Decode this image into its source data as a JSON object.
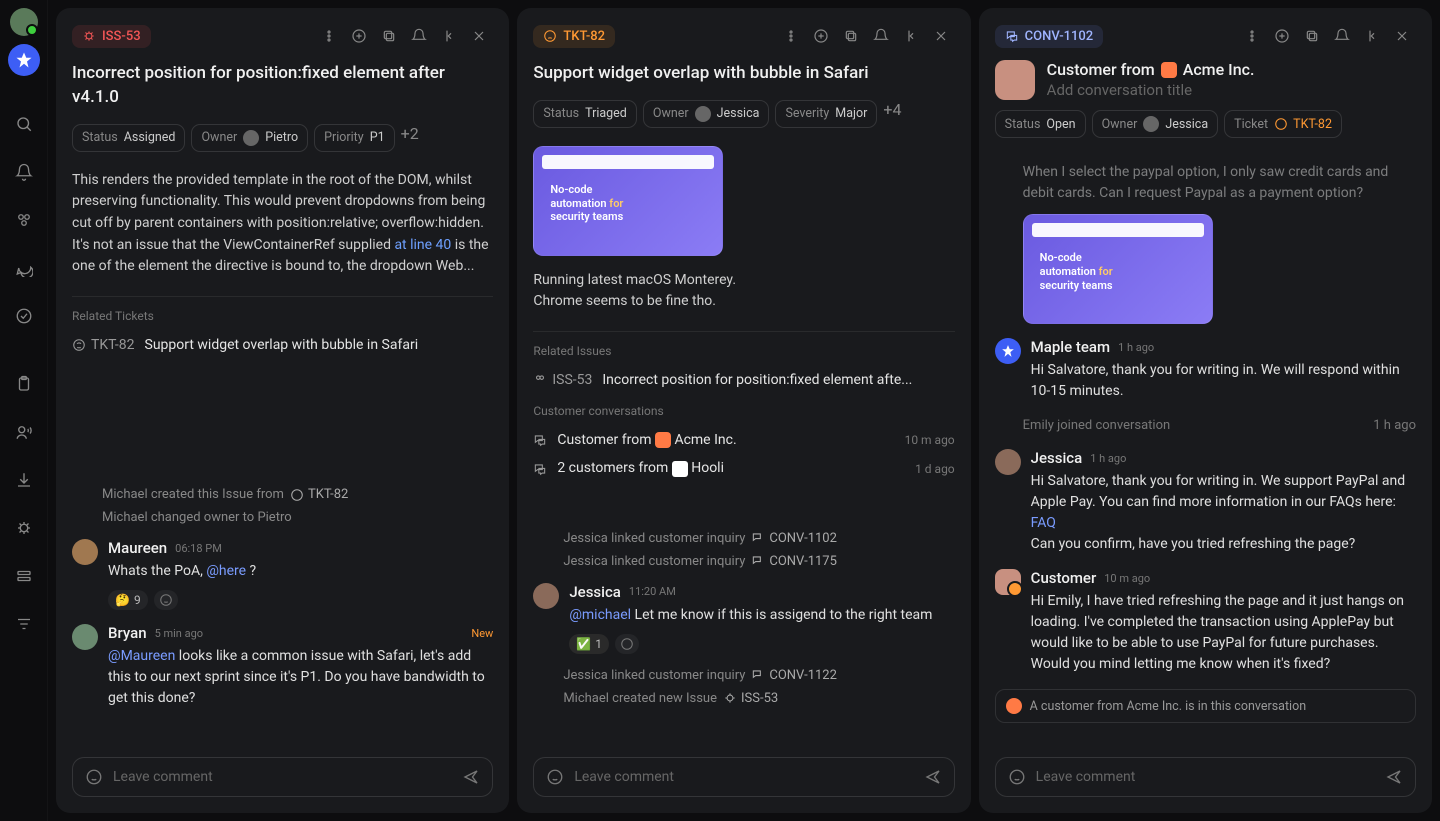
{
  "rail": {
    "icons": [
      "search",
      "bell",
      "team",
      "chat",
      "check",
      "clipboard",
      "speaker",
      "download",
      "bug",
      "cards",
      "filter"
    ]
  },
  "col1": {
    "tag": "ISS-53",
    "title": "Incorrect position for position:fixed element after v4.1.0",
    "chips": {
      "status_l": "Status",
      "status_v": "Assigned",
      "owner_l": "Owner",
      "owner_v": "Pietro",
      "priority_l": "Priority",
      "priority_v": "P1",
      "more": "+2"
    },
    "body_a": "This renders the provided template in the root of the DOM, whilst preserving functionality. This would prevent dropdowns from being cut off by parent containers with position:relative; overflow:hidden. It's not an issue that the ViewContainerRef supplied ",
    "body_link": "at line 40",
    "body_b": " is the one of the element the directive is bound to, the dropdown Web...",
    "related_label": "Related Tickets",
    "related": {
      "id": "TKT-82",
      "title": "Support widget overlap with bubble in Safari"
    },
    "act1": "Michael created this Issue from",
    "act1_id": "TKT-82",
    "act2": "Michael changed owner to Pietro",
    "c1": {
      "author": "Maureen",
      "time": "06:18 PM",
      "body_a": "Whats the PoA, ",
      "mention": "@here",
      "body_b": " ?",
      "react_emoji": "🤔",
      "react_n": "9"
    },
    "c2": {
      "author": "Bryan",
      "time": "5 min ago",
      "new": "New",
      "mention": "@Maureen",
      "body": " looks like a common issue with Safari, let's add this to our next sprint since it's P1. Do you have bandwidth to get this done?"
    },
    "input": "Leave comment"
  },
  "col2": {
    "tag": "TKT-82",
    "title": "Support widget overlap with bubble in Safari",
    "chips": {
      "status_l": "Status",
      "status_v": "Triaged",
      "owner_l": "Owner",
      "owner_v": "Jessica",
      "sev_l": "Severity",
      "sev_v": "Major",
      "more": "+4"
    },
    "thumb_a": "No-code automation ",
    "thumb_b": "for",
    "thumb_c": " security teams",
    "body_l1": "Running latest macOS Monterey.",
    "body_l2": "Chrome seems to be fine tho.",
    "rel_issues_label": "Related Issues",
    "rel_issue": {
      "id": "ISS-53",
      "title": "Incorrect position for position:fixed element afte..."
    },
    "conv_label": "Customer conversations",
    "conv1": {
      "pre": "Customer from",
      "org": "Acme Inc.",
      "time": "10 m ago"
    },
    "conv2": {
      "pre": "2 customers from",
      "org": "Hooli",
      "time": "1 d ago"
    },
    "act1": "Jessica linked customer inquiry",
    "act1_id": "CONV-1102",
    "act2": "Jessica linked customer inquiry",
    "act2_id": "CONV-1175",
    "c1": {
      "author": "Jessica",
      "time": "11:20 AM",
      "mention": "@michael",
      "body": " Let me know if this is assigend to the right team",
      "react": "1"
    },
    "act3": "Jessica linked customer inquiry",
    "act3_id": "CONV-1122",
    "act4": "Michael created new Issue",
    "act4_id": "ISS-53",
    "input": "Leave comment"
  },
  "col3": {
    "tag": "CONV-1102",
    "org_pre": "Customer from",
    "org": "Acme Inc.",
    "subtitle": "Add conversation title",
    "chips": {
      "status_l": "Status",
      "status_v": "Open",
      "owner_l": "Owner",
      "owner_v": "Jessica",
      "ticket_l": "Ticket",
      "ticket_v": "TKT-82"
    },
    "peek": "When I select the paypal option, I only saw credit cards and debit cards. Can I request Paypal as a payment option?",
    "m1": {
      "author": "Maple team",
      "time": "1 h ago",
      "body": "Hi Salvatore, thank you for writing in. We will respond within 10-15 minutes."
    },
    "joined": "Emily joined conversation",
    "joined_time": "1 h ago",
    "m2": {
      "author": "Jessica",
      "time": "1 h ago",
      "body_a": "Hi Salvatore, thank you for writing in. We support PayPal and Apple Pay. You can find more information in our FAQs here: ",
      "link": "FAQ",
      "body_b": "Can you confirm, have you tried refreshing the page?"
    },
    "m3": {
      "author": "Customer",
      "time": "10 m ago",
      "body": "Hi Emily, I have tried refreshing the page and it just hangs on loading. I've completed the transaction using ApplePay but would like to be able to use PayPal for future purchases. Would you mind letting me know when it's fixed?"
    },
    "notice": "A customer from Acme Inc. is in this conversation",
    "input": "Leave comment"
  }
}
